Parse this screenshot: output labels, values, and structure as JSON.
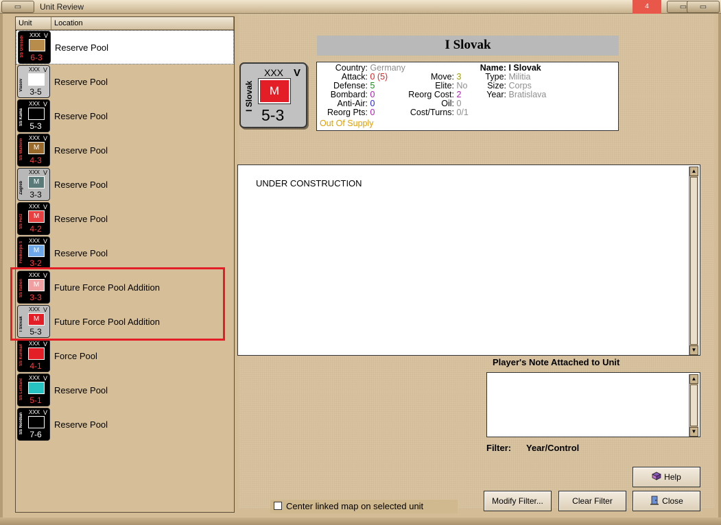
{
  "window": {
    "title": "Unit Review",
    "red_btn": "4"
  },
  "list": {
    "col_unit": "Unit",
    "col_location": "Location",
    "rows": [
      {
        "location": "Reserve Pool",
        "name": "SS Grossdeutschland",
        "size": "XXX",
        "mark": "V",
        "symbol": "",
        "strength": "6-3",
        "bg": "#000000",
        "sym_bg": "#b88c4a",
        "text": "#ff4040",
        "selected": true
      },
      {
        "location": "Reserve Pool",
        "name": "Vlasov",
        "size": "XXX",
        "mark": "V",
        "symbol": "",
        "strength": "3-5",
        "bg": "#c6c6c6",
        "sym_bg": "#ffffff",
        "text": "#000000",
        "selected": false
      },
      {
        "location": "Reserve Pool",
        "name": "SS Kama",
        "size": "XXX",
        "mark": "V",
        "symbol": "",
        "strength": "5-3",
        "bg": "#000000",
        "sym_bg": "#000000",
        "text": "#ffffff",
        "selected": false
      },
      {
        "location": "Reserve Pool",
        "name": "SS Wallonien",
        "size": "XXX",
        "mark": "V",
        "symbol": "M",
        "strength": "4-3",
        "bg": "#000000",
        "sym_bg": "#9a6a2d",
        "text": "#ff4040",
        "selected": false
      },
      {
        "location": "Reserve Pool",
        "name": "Zagreb",
        "size": "XXX",
        "mark": "V",
        "symbol": "M",
        "strength": "3-3",
        "bg": "#b8b8b8",
        "sym_bg": "#5a7a7a",
        "text": "#000000",
        "selected": false
      },
      {
        "location": "Reserve Pool",
        "name": "SS Hetz",
        "size": "XXX",
        "mark": "V",
        "symbol": "M",
        "strength": "4-2",
        "bg": "#000000",
        "sym_bg": "#e84040",
        "text": "#ff4040",
        "selected": false
      },
      {
        "location": "Reserve Pool",
        "name": "Freikorps SS",
        "size": "XXX",
        "mark": "V",
        "symbol": "M",
        "strength": "3-2",
        "bg": "#000000",
        "sym_bg": "#6ea8e8",
        "text": "#ff4040",
        "selected": false
      },
      {
        "location": "Future Force Pool Addition",
        "name": "SS Italien",
        "size": "XXX",
        "mark": "V",
        "symbol": "M",
        "strength": "3-3",
        "bg": "#000000",
        "sym_bg": "#f0a0a0",
        "text": "#ff4040",
        "selected": false
      },
      {
        "location": "Future Force Pool Addition",
        "name": "I Slovak",
        "size": "XXX",
        "mark": "V",
        "symbol": "M",
        "strength": "5-3",
        "bg": "#bdbdbd",
        "sym_bg": "#e31e26",
        "text": "#000000",
        "selected": false
      },
      {
        "location": "Force Pool",
        "name": "SS Kurmark",
        "size": "XXX",
        "mark": "V",
        "symbol": "",
        "strength": "4-1",
        "bg": "#000000",
        "sym_bg": "#e31e26",
        "text": "#ff4040",
        "selected": false
      },
      {
        "location": "Reserve Pool",
        "name": "SS Lettland",
        "size": "XXX",
        "mark": "V",
        "symbol": "",
        "strength": "5-1",
        "bg": "#000000",
        "sym_bg": "#27c3c3",
        "text": "#ff4040",
        "selected": false
      },
      {
        "location": "Reserve Pool",
        "name": "SS Nordland",
        "size": "XXX",
        "mark": "V",
        "symbol": "",
        "strength": "7-6",
        "bg": "#000000",
        "sym_bg": "#000000",
        "text": "#ffffff",
        "selected": false
      }
    ]
  },
  "detail": {
    "unit_name": "I Slovak",
    "counter": {
      "size": "XXX",
      "mark": "V",
      "name": "I Slovak",
      "symbol": "M",
      "strength": "5-3"
    },
    "stats": {
      "country_label": "Country:",
      "country": "Germany",
      "attack_label": "Attack:",
      "attack": "0",
      "attack_paren": "(5)",
      "defense_label": "Defense:",
      "defense": "5",
      "bombard_label": "Bombard:",
      "bombard": "0",
      "antiair_label": "Anti-Air:",
      "antiair": "0",
      "reorgpts_label": "Reorg Pts:",
      "reorgpts": "0",
      "supply": "Out Of Supply",
      "move_label": "Move:",
      "move": "3",
      "elite_label": "Elite:",
      "elite": "No",
      "reorgcost_label": "Reorg Cost:",
      "reorgcost": "2",
      "oil_label": "Oil:",
      "oil": "0",
      "costturns_label": "Cost/Turns:",
      "costturns": "0/1",
      "name_label": "Name:",
      "name": "I Slovak",
      "type_label": "Type:",
      "type": "Militia",
      "size_label": "Size:",
      "size": "Corps",
      "year_label": "Year:",
      "year": "Bratislava"
    },
    "description": "UNDER CONSTRUCTION",
    "note_label": "Player's Note Attached to Unit",
    "filter_label": "Filter:",
    "filter_value": "Year/Control"
  },
  "buttons": {
    "help": "Help",
    "modify_filter": "Modify Filter...",
    "clear_filter": "Clear Filter",
    "close": "Close"
  },
  "checkbox": {
    "label": "Center linked map on selected unit",
    "checked": false
  }
}
